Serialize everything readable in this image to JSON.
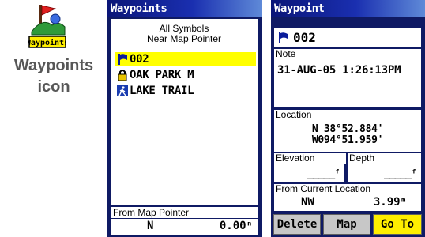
{
  "icon_caption": {
    "icon_label": "Waypoints",
    "line1": "Waypoints",
    "line2": "icon"
  },
  "list_screen": {
    "title": "Waypoints",
    "filter_line1": "All Symbols",
    "filter_line2": "Near Map Pointer",
    "waypoints": [
      {
        "symbol": "flag-icon",
        "name": "002",
        "selected": true
      },
      {
        "symbol": "lock-icon",
        "name": "OAK PARK M",
        "selected": false
      },
      {
        "symbol": "hiker-icon",
        "name": "LAKE TRAIL",
        "selected": false
      }
    ],
    "from_pointer_label": "From Map Pointer",
    "from_pointer_bearing": "N",
    "from_pointer_distance": "0.00ⁿ",
    "highlight_color": "#ffff00"
  },
  "detail_screen": {
    "title": "Waypoint",
    "name": "002",
    "note_label": "Note",
    "note_value": "31-AUG-05 1:26:13PM",
    "location_label": "Location",
    "location_lat": "N  38°52.884'",
    "location_lon": "W094°51.959'",
    "elevation_label": "Elevation",
    "elevation_value": "_____ᶠ",
    "depth_label": "Depth",
    "depth_value": "_____ᶠ",
    "from_current_label": "From Current Location",
    "from_current_bearing": "NW",
    "from_current_distance": "3.99ᵐ",
    "buttons": {
      "delete": "Delete",
      "map": "Map",
      "goto": "Go To"
    },
    "goto_color": "#ffee00"
  }
}
